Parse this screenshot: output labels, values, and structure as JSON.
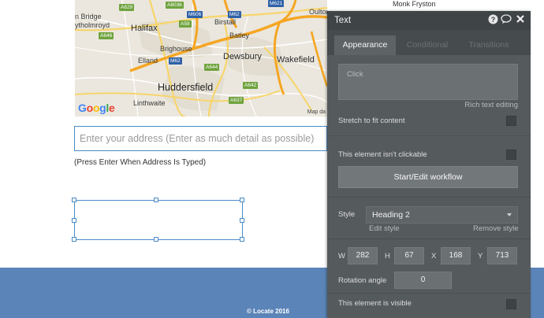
{
  "map": {
    "labels": {
      "bridge": "n Bridge",
      "mytholmroyd": "ytholmroyd",
      "halifax": "Halifax",
      "birstall": "Birstall",
      "batley": "Batley",
      "brighouse": "Brighouse",
      "elland": "Elland",
      "dewsbury": "Dewsbury",
      "wakefield": "Wakefield",
      "huddersfield": "Huddersfield",
      "linthwaite": "Linthwaite",
      "oulton": "Oulton"
    },
    "shields": {
      "a629": "A629",
      "a6036": "A6036",
      "m606": "M606",
      "m62_top": "M62",
      "m621": "M621",
      "a646": "A646",
      "a58": "A58",
      "m62_mid": "M62",
      "a644": "A644",
      "a642": "A642",
      "a637": "A637"
    },
    "logo_letters": [
      "G",
      "o",
      "o",
      "g",
      "l",
      "e"
    ],
    "data_label": "Map da"
  },
  "background_label": "Monk Fryston",
  "address": {
    "placeholder": "Enter your address (Enter as much detail as possible)",
    "hint": "(Press Enter When Address Is Typed)"
  },
  "footer": {
    "text": "© Locate 2016"
  },
  "panel": {
    "title": "Text",
    "icons": [
      "help-icon",
      "comment-icon",
      "close-icon"
    ],
    "tabs": [
      {
        "label": "Appearance",
        "active": true
      },
      {
        "label": "Conditional",
        "active": false
      },
      {
        "label": "Transitions",
        "active": false
      }
    ],
    "text_value": "Click",
    "rich_text_label": "Rich text editing",
    "stretch_label": "Stretch to fit content",
    "not_clickable_label": "This element isn't clickable",
    "workflow_button": "Start/Edit workflow",
    "style_label": "Style",
    "style_value": "Heading 2",
    "edit_style": "Edit style",
    "remove_style": "Remove style",
    "dims": {
      "w_label": "W",
      "w": "282",
      "h_label": "H",
      "h": "67",
      "x_label": "X",
      "x": "168",
      "y_label": "Y",
      "y": "713"
    },
    "rotation_label": "Rotation angle",
    "rotation": "0",
    "visible_label": "This element is visible"
  },
  "colors": {
    "panel_bg": "#555a5d",
    "panel_header": "#3f4447",
    "footer_bg": "#5b84b8",
    "selection": "#4a8cc7",
    "road_orange": "#f5a623"
  }
}
